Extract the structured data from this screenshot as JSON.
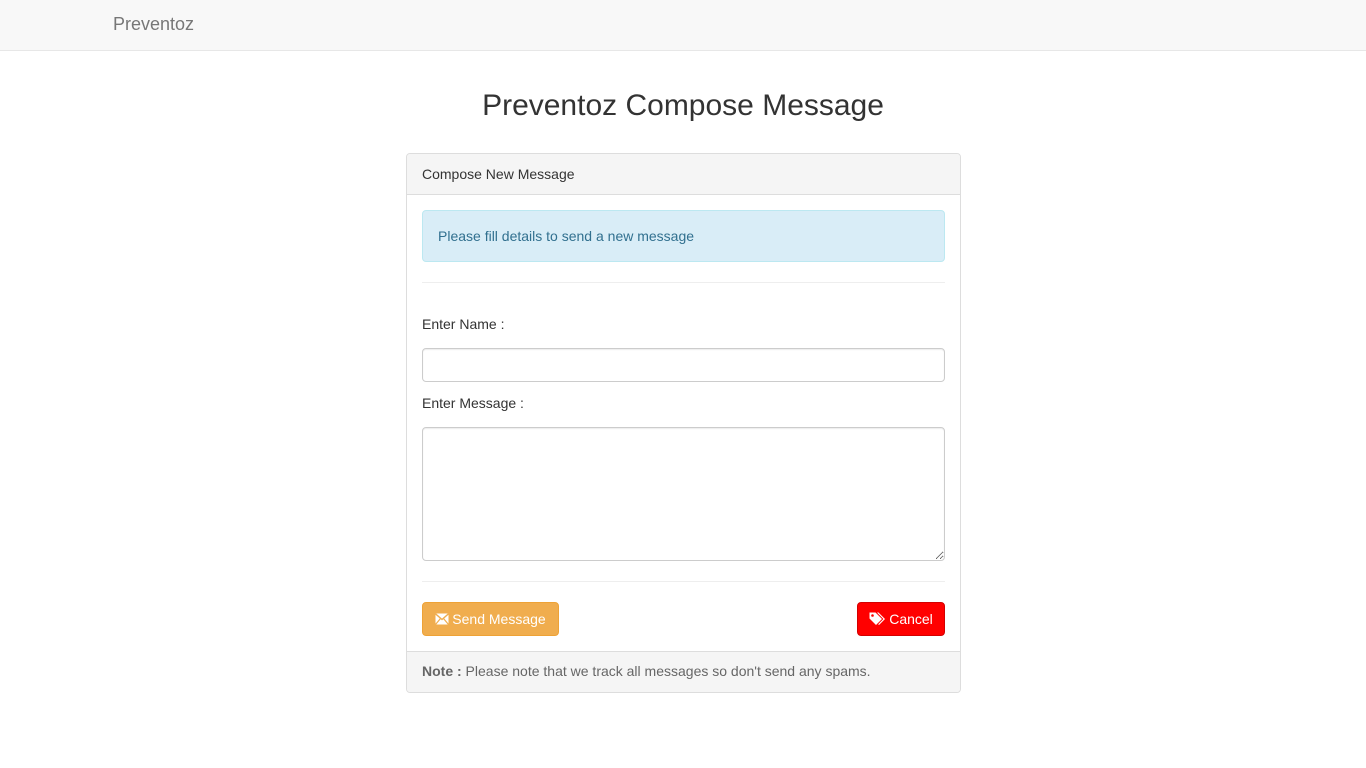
{
  "navbar": {
    "brand": "Preventoz"
  },
  "page": {
    "title": "Preventoz Compose Message"
  },
  "panel": {
    "heading": "Compose New Message",
    "alert": "Please fill details to send a new message",
    "name_label": "Enter Name :",
    "name_value": "",
    "message_label": "Enter Message :",
    "message_value": "",
    "send_label": "Send Message",
    "cancel_label": "Cancel",
    "send_icon": "envelope-icon",
    "cancel_icon": "tags-icon",
    "footer_note_label": "Note :",
    "footer_note_text": " Please note that we track all messages so don't send any spams."
  },
  "colors": {
    "send_button": "#f0ad4e",
    "cancel_button": "#ff0000",
    "alert_background": "#d9edf7",
    "alert_text": "#31708f"
  }
}
